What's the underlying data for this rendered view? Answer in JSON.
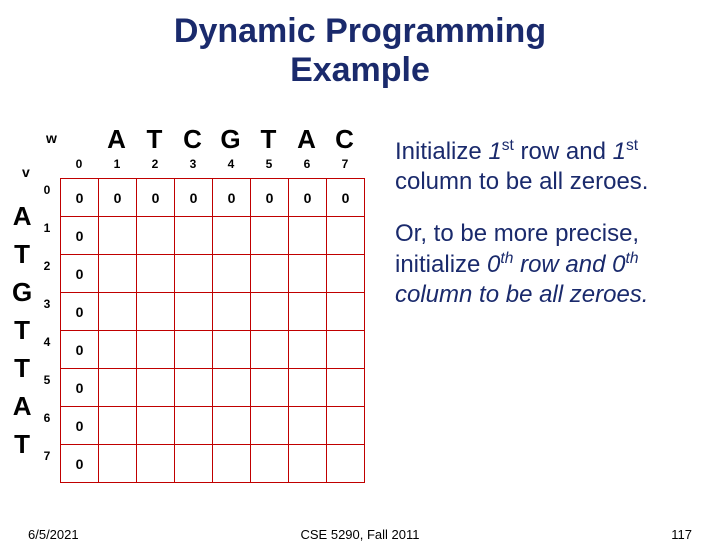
{
  "title_line1": "Dynamic Programming",
  "title_line2": "Example",
  "axis": {
    "w": "w",
    "v": "v"
  },
  "w_letters": [
    "A",
    "T",
    "C",
    "G",
    "T",
    "A",
    "C"
  ],
  "v_letters": [
    "A",
    "T",
    "G",
    "T",
    "T",
    "A",
    "T"
  ],
  "col_indices": [
    "0",
    "1",
    "2",
    "3",
    "4",
    "5",
    "6",
    "7"
  ],
  "row_indices": [
    "0",
    "1",
    "2",
    "3",
    "4",
    "5",
    "6",
    "7"
  ],
  "grid": [
    [
      "0",
      "0",
      "0",
      "0",
      "0",
      "0",
      "0",
      "0"
    ],
    [
      "0",
      "",
      "",
      "",
      "",
      "",
      "",
      ""
    ],
    [
      "0",
      "",
      "",
      "",
      "",
      "",
      "",
      ""
    ],
    [
      "0",
      "",
      "",
      "",
      "",
      "",
      "",
      ""
    ],
    [
      "0",
      "",
      "",
      "",
      "",
      "",
      "",
      ""
    ],
    [
      "0",
      "",
      "",
      "",
      "",
      "",
      "",
      ""
    ],
    [
      "0",
      "",
      "",
      "",
      "",
      "",
      "",
      ""
    ],
    [
      "0",
      "",
      "",
      "",
      "",
      "",
      "",
      ""
    ]
  ],
  "para1": {
    "p1": "Initialize ",
    "n1": "1",
    "s1": "st",
    "p2": " row and ",
    "n2": "1",
    "s2": "st",
    "p3": "  column to be all zeroes."
  },
  "para2": {
    "p1": "Or, to be more precise, initialize ",
    "n1": "0",
    "s1": "th",
    "p2": " row and ",
    "n2": "0",
    "s2": "th",
    "p3": " column to be all zeroes."
  },
  "footer": {
    "date": "6/5/2021",
    "course": "CSE 5290, Fall 2011",
    "page": "117"
  },
  "chart_data": {
    "type": "table",
    "title": "DP alignment matrix initialization",
    "row_sequence": "ATGTTAT",
    "col_sequence": "ATCGTAC",
    "rows": 8,
    "cols": 8,
    "initialized_cells": {
      "row0": [
        0,
        0,
        0,
        0,
        0,
        0,
        0,
        0
      ],
      "col0": [
        0,
        0,
        0,
        0,
        0,
        0,
        0,
        0
      ]
    }
  }
}
